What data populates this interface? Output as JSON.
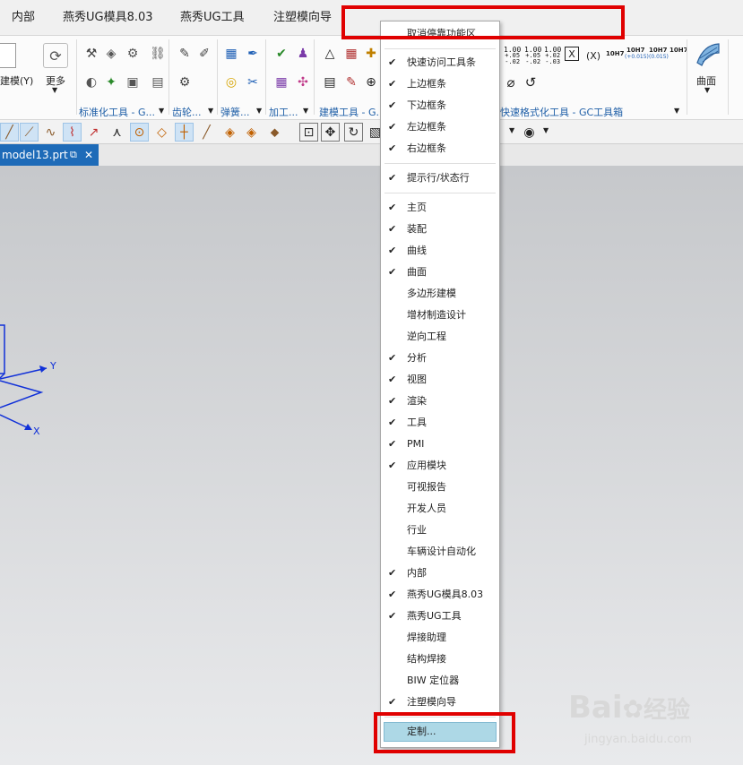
{
  "menubar": {
    "tabs": [
      {
        "label": "内部"
      },
      {
        "label": "燕秀UG模具8.03"
      },
      {
        "label": "燕秀UG工具"
      },
      {
        "label": "注塑模向导"
      }
    ]
  },
  "ribbon": {
    "left_buttons": {
      "build_label": "建模(Y)",
      "more_label": "更多"
    },
    "groups": [
      {
        "label": "标准化工具 - G..."
      },
      {
        "label": "齿轮..."
      },
      {
        "label": "弹簧..."
      },
      {
        "label": "加工..."
      },
      {
        "label": "建模工具 - G..."
      },
      {
        "label": "快速格式化工具 - GC工具箱"
      }
    ],
    "tol_labels": [
      {
        "top": "1.00",
        "mid": "+.05",
        "bot": "-.02"
      },
      {
        "top": "1.00",
        "mid": "+.05",
        "bot": "-.02"
      },
      {
        "top": "1.00",
        "mid": "+.02",
        "bot": "-.03"
      }
    ],
    "fit_labels": [
      "10H7",
      "10H7",
      "10H7"
    ],
    "fit_subs": [
      "(+0.015)",
      "(0.015)"
    ],
    "surface_label": "曲面"
  },
  "file_tab": {
    "name": "model13.prt"
  },
  "axes": {
    "y_label": "Y",
    "x_label": "X"
  },
  "context_menu": {
    "header": "取消停靠功能区",
    "items": [
      {
        "label": "快速访问工具条",
        "checked": true
      },
      {
        "label": "上边框条",
        "checked": true
      },
      {
        "label": "下边框条",
        "checked": true
      },
      {
        "label": "左边框条",
        "checked": true
      },
      {
        "label": "右边框条",
        "checked": true
      },
      {
        "label": "提示行/状态行",
        "checked": true
      },
      {
        "label": "主页",
        "checked": true
      },
      {
        "label": "装配",
        "checked": true
      },
      {
        "label": "曲线",
        "checked": true
      },
      {
        "label": "曲面",
        "checked": true
      },
      {
        "label": "多边形建模",
        "checked": false
      },
      {
        "label": "增材制造设计",
        "checked": false
      },
      {
        "label": "逆向工程",
        "checked": false
      },
      {
        "label": "分析",
        "checked": true
      },
      {
        "label": "视图",
        "checked": true
      },
      {
        "label": "渲染",
        "checked": true
      },
      {
        "label": "工具",
        "checked": true
      },
      {
        "label": "PMI",
        "checked": true
      },
      {
        "label": "应用模块",
        "checked": true
      },
      {
        "label": "可视报告",
        "checked": false
      },
      {
        "label": "开发人员",
        "checked": false
      },
      {
        "label": "行业",
        "checked": false
      },
      {
        "label": "车辆设计自动化",
        "checked": false
      },
      {
        "label": "内部",
        "checked": true
      },
      {
        "label": "燕秀UG模具8.03",
        "checked": true
      },
      {
        "label": "燕秀UG工具",
        "checked": true
      },
      {
        "label": "焊接助理",
        "checked": false
      },
      {
        "label": "结构焊接",
        "checked": false
      },
      {
        "label": "BIW 定位器",
        "checked": false
      },
      {
        "label": "注塑模向导",
        "checked": true
      }
    ],
    "customize": "定制..."
  },
  "watermark": {
    "brand": "Bai",
    "brand2": "经验",
    "url": "jingyan.baidu.com"
  },
  "colors": {
    "accent_blue": "#1e6bb8",
    "highlight_red": "#e00000",
    "selected_item": "#add8e6"
  }
}
